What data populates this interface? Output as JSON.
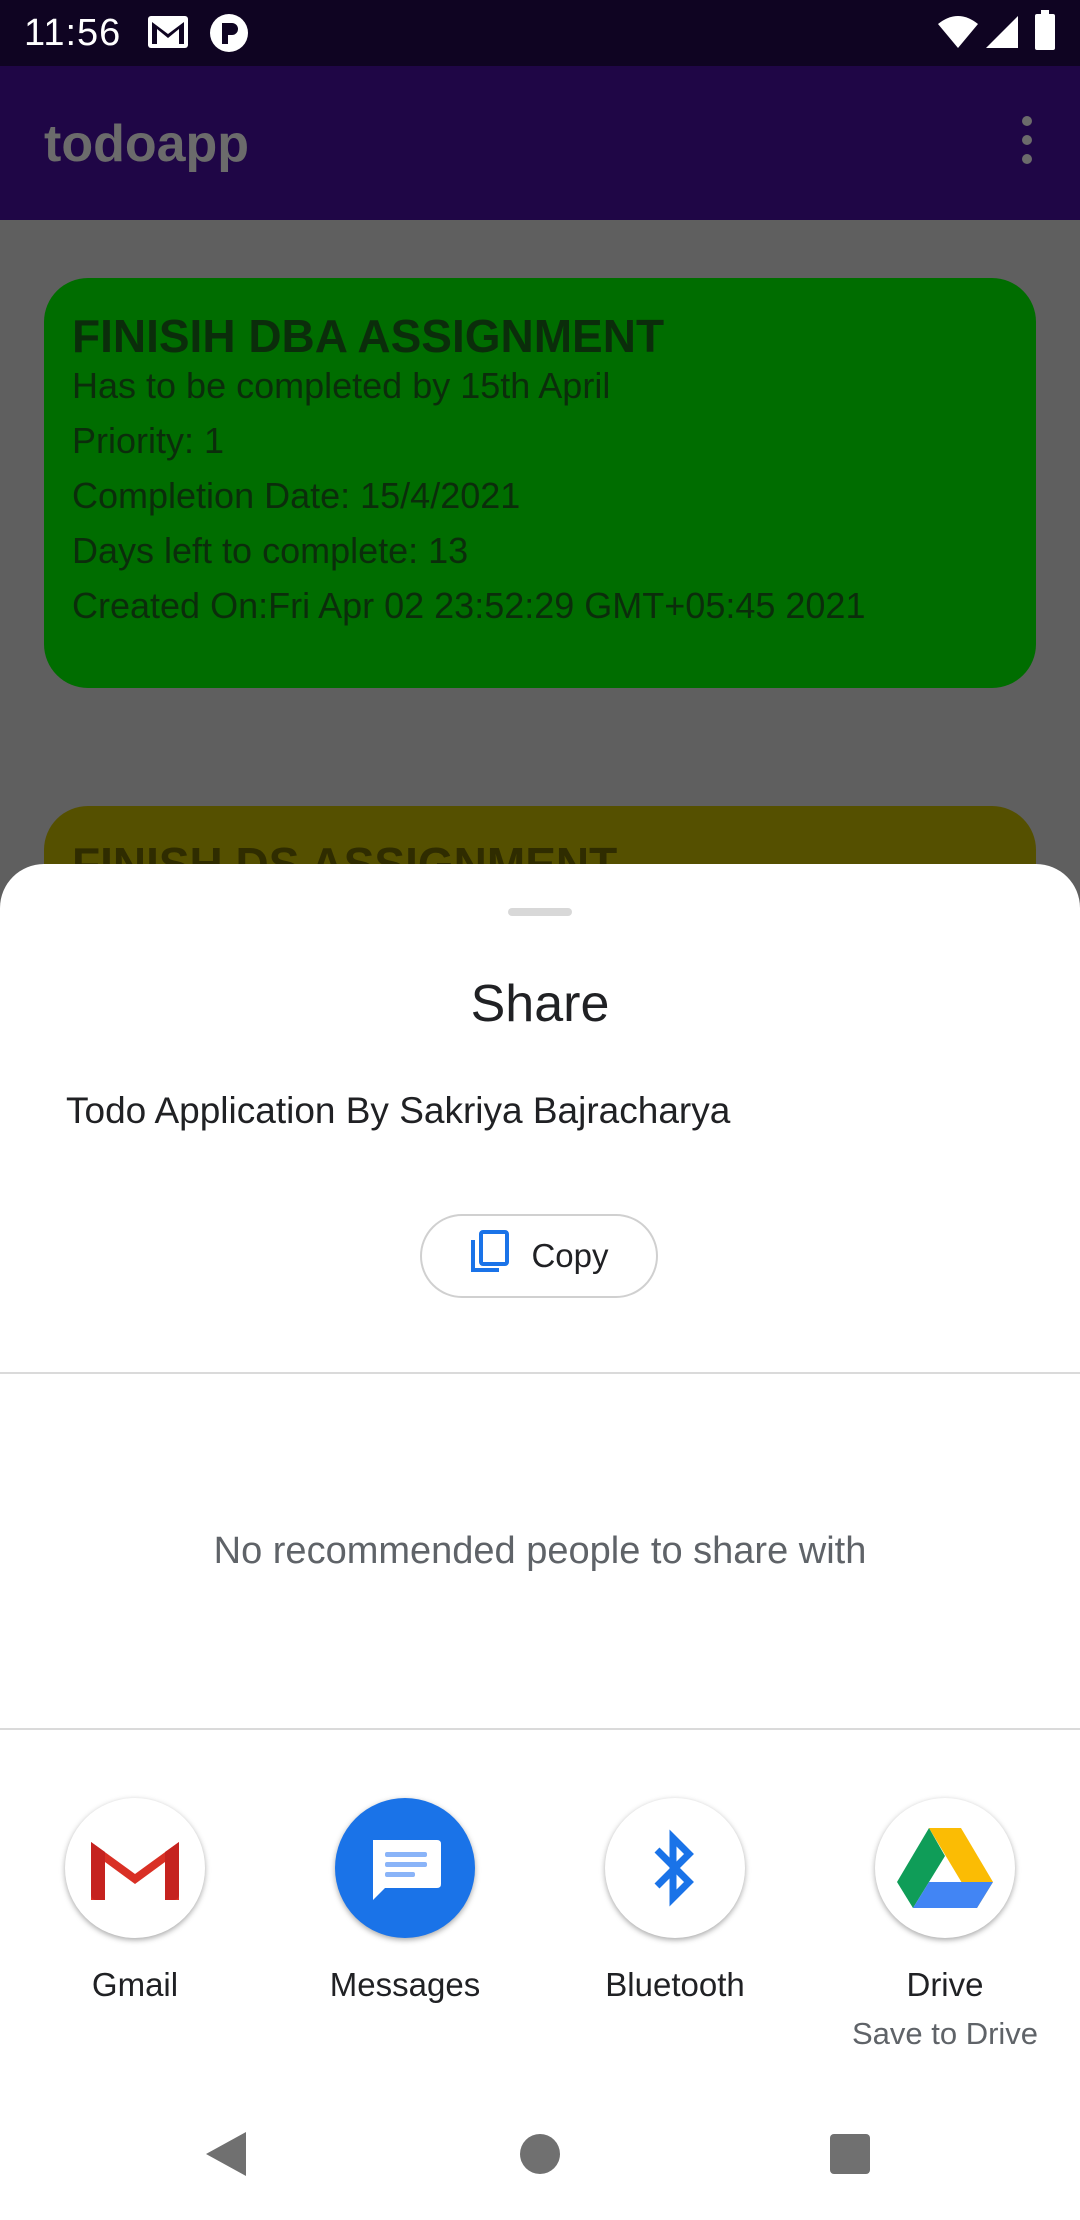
{
  "status": {
    "time": "11:56"
  },
  "app": {
    "title": "todoapp"
  },
  "cards": [
    {
      "title": "FINISIH DBA ASSIGNMENT",
      "lines": [
        "Has to be completed by 15th April",
        "Priority: 1",
        "Completion Date: 15/4/2021",
        "Days left to complete: 13",
        "Created On:Fri Apr 02 23:52:29 GMT+05:45 2021"
      ],
      "color": "#006d00"
    },
    {
      "title": "FINISH DS ASSIGNMENT",
      "color": "#555000"
    }
  ],
  "share": {
    "title": "Share",
    "text": "Todo Application By Sakriya Bajracharya",
    "copy_label": "Copy",
    "no_people": "No recommended people to share with",
    "apps": [
      {
        "label": "Gmail",
        "icon": "gmail-icon"
      },
      {
        "label": "Messages",
        "icon": "messages-icon"
      },
      {
        "label": "Bluetooth",
        "icon": "bluetooth-icon"
      },
      {
        "label": "Drive",
        "sub": "Save to Drive",
        "icon": "drive-icon"
      }
    ]
  },
  "colors": {
    "accent": "#1a73e8",
    "appbar": "#1f0646",
    "statusbar": "#0f0422"
  }
}
